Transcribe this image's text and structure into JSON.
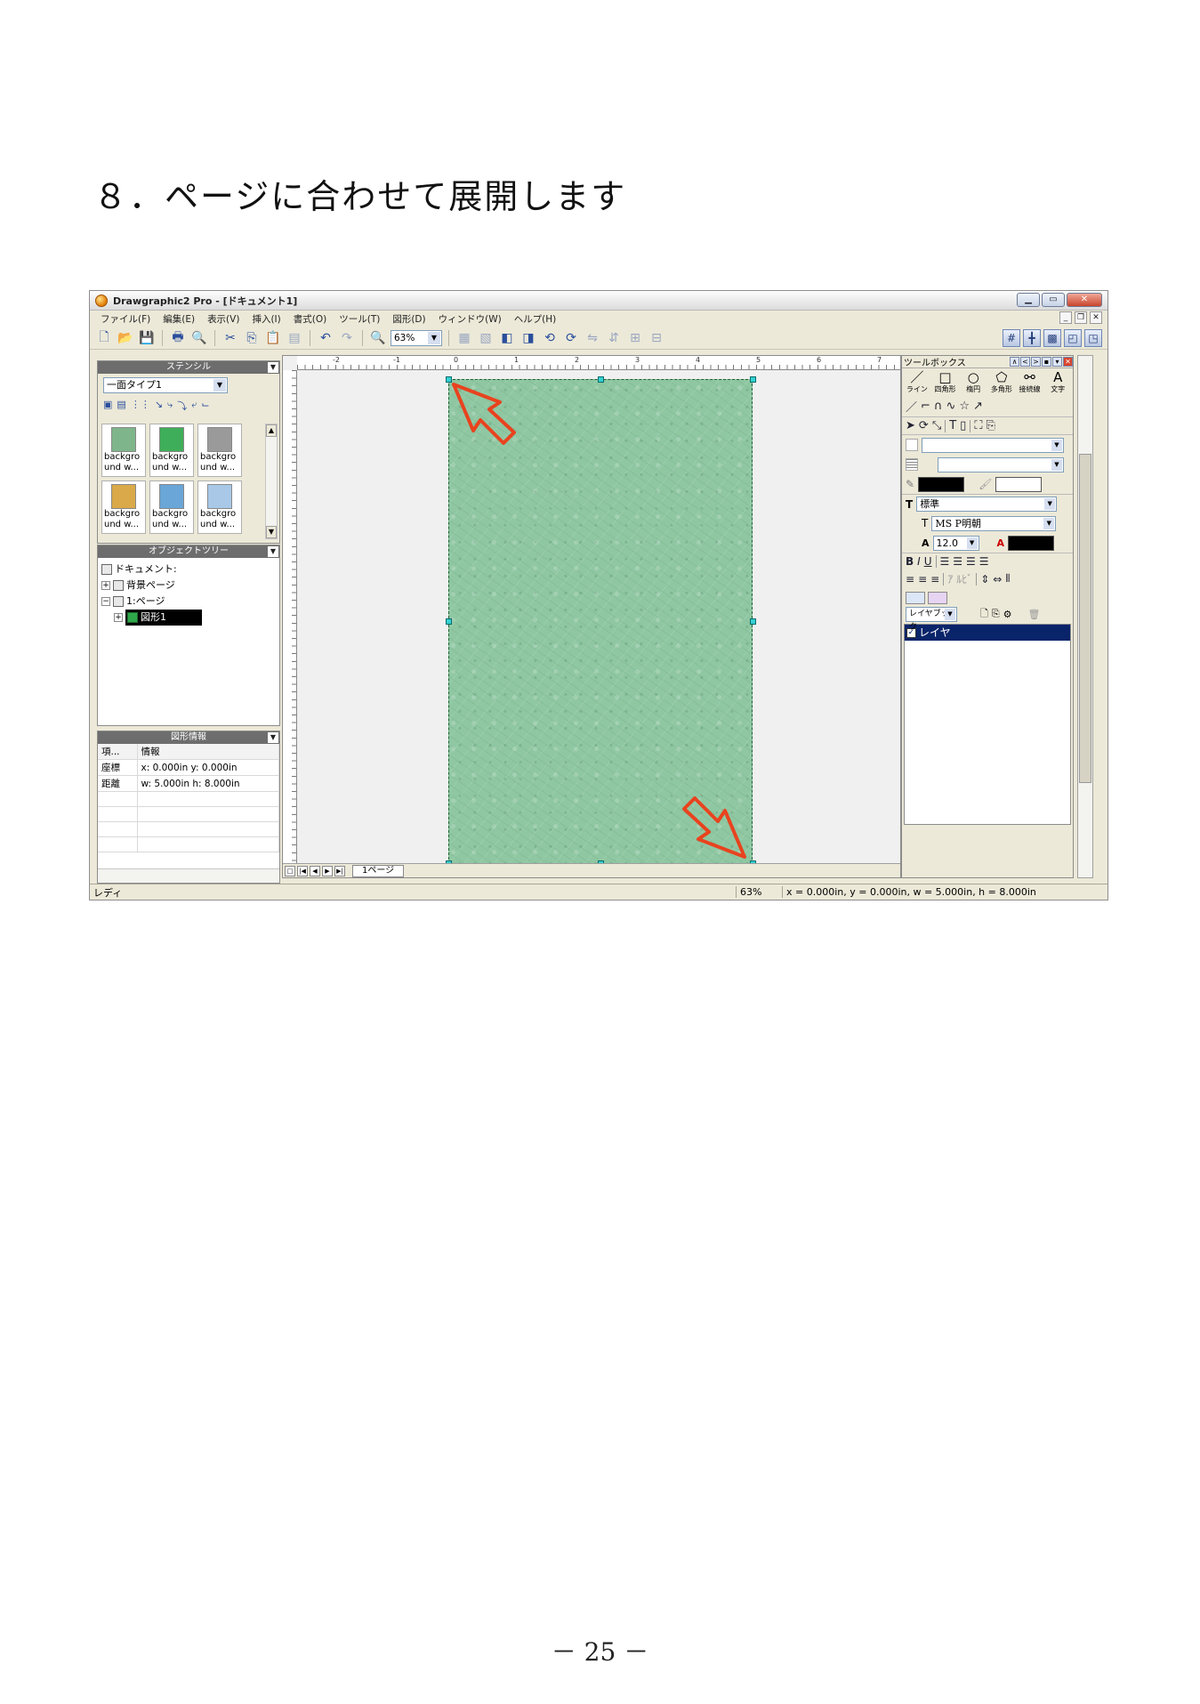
{
  "heading": "８．ページに合わせて展開します",
  "page_number": "－ 25 －",
  "window": {
    "title": "Drawgraphic2 Pro - [ドキュメント1]",
    "menu": [
      "ファイル(F)",
      "編集(E)",
      "表示(V)",
      "挿入(I)",
      "書式(O)",
      "ツール(T)",
      "図形(D)",
      "ウィンドウ(W)",
      "ヘルプ(H)"
    ],
    "zoom": "63%"
  },
  "stencil": {
    "header": "ステンシル",
    "selected": "一面タイプ1",
    "items": [
      {
        "label": "backgro und w...",
        "color": "#7fb58a"
      },
      {
        "label": "backgro und w...",
        "color": "#3fae5a"
      },
      {
        "label": "backgro und w...",
        "color": "#9a9a9a"
      },
      {
        "label": "backgro und w...",
        "color": "#d9a94a"
      },
      {
        "label": "backgro und w...",
        "color": "#6aa6d8"
      },
      {
        "label": "backgro und w...",
        "color": "#a9c8e8"
      }
    ]
  },
  "object_tree": {
    "header": "オブジェクトツリー",
    "document": "ドキュメント:",
    "background_page": "背景ページ",
    "page": "1:ページ",
    "shape": "図形1"
  },
  "shape_info": {
    "header": "図形情報",
    "col_item": "項...",
    "col_info": "情報",
    "rows": [
      {
        "item": "座標",
        "info": "x: 0.000in y: 0.000in"
      },
      {
        "item": "距離",
        "info": "w: 5.000in h: 8.000in"
      }
    ]
  },
  "canvas": {
    "page_tab": "1ページ",
    "ruler_labels": [
      "-2",
      "-1",
      "0",
      "1",
      "2",
      "3",
      "4",
      "5",
      "6",
      "7"
    ]
  },
  "toolbox": {
    "header": "ツールボックス",
    "shapes": [
      {
        "icon": "／",
        "label": "ライン"
      },
      {
        "icon": "□",
        "label": "四角形"
      },
      {
        "icon": "○",
        "label": "楕円"
      },
      {
        "icon": "⬠",
        "label": "多角形"
      },
      {
        "icon": "⚯",
        "label": "接続線"
      },
      {
        "icon": "A",
        "label": "文字"
      }
    ],
    "style": "標準",
    "font": "MS P明朝",
    "font_size": "12.0",
    "layer_button": "レイヤブック",
    "layer": "レイヤ"
  },
  "status": {
    "ready": "レディ",
    "zoom": "63%",
    "coords": "x = 0.000in, y = 0.000in, w = 5.000in, h = 8.000in"
  },
  "colors": {
    "page_green": "#8fc7a2",
    "arrow_red": "#e8431e",
    "selection_handle": "#33d1d1"
  }
}
